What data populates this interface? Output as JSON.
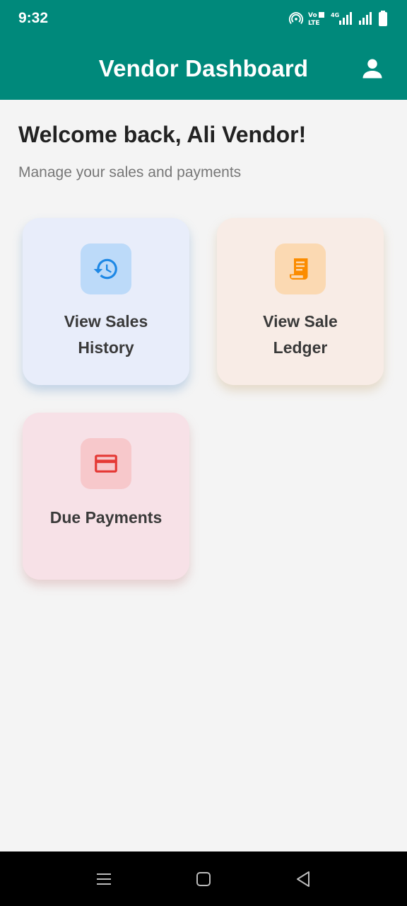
{
  "status_bar": {
    "time": "9:32",
    "icons": [
      "hotspot-icon",
      "volte-icon",
      "signal-4g-icon",
      "signal-icon",
      "battery-icon"
    ],
    "volte_text": "Vo LTE",
    "network_text": "4G"
  },
  "app_bar": {
    "title": "Vendor Dashboard",
    "profile_icon": "person-icon"
  },
  "main": {
    "welcome": "Welcome back, Ali Vendor!",
    "subtitle": "Manage your sales and payments",
    "cards": [
      {
        "label": "View Sales History",
        "icon": "history-icon",
        "color": "#1e88e5"
      },
      {
        "label": "View Sale Ledger",
        "icon": "receipt-icon",
        "color": "#fb8c00"
      },
      {
        "label": "Due Payments",
        "icon": "credit-card-icon",
        "color": "#e53935"
      }
    ]
  },
  "nav_bar": {
    "buttons": [
      "menu-icon",
      "home-square-icon",
      "back-triangle-icon"
    ]
  },
  "colors": {
    "primary": "#00897b",
    "background": "#f4f4f4"
  }
}
